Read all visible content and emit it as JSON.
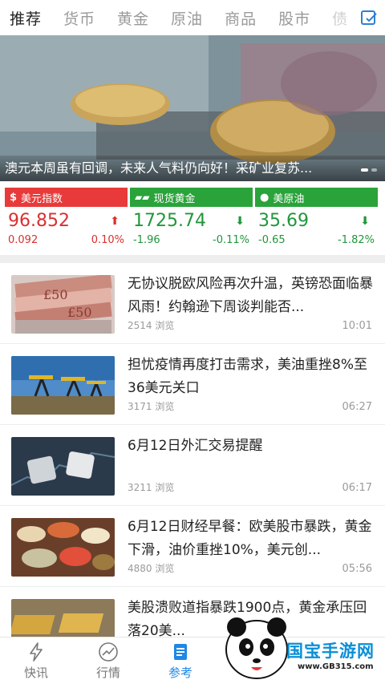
{
  "tabs": [
    "推荐",
    "货币",
    "黄金",
    "原油",
    "商品",
    "股市",
    "债"
  ],
  "banner": {
    "caption": "澳元本周虽有回调，未来人气料仍向好！采矿业复苏..."
  },
  "markets": [
    {
      "name": "美元指数",
      "price": "96.852",
      "change": "0.092",
      "percent": "0.10%",
      "trend": "up",
      "color": "#e83a3a"
    },
    {
      "name": "现货黄金",
      "price": "1725.74",
      "change": "-1.96",
      "percent": "-0.11%",
      "trend": "down",
      "color": "#2aa33a"
    },
    {
      "name": "美原油",
      "price": "35.69",
      "change": "-0.65",
      "percent": "-1.82%",
      "trend": "down",
      "color": "#2aa33a"
    }
  ],
  "news": [
    {
      "title": "无协议脱欧风险再次升温，英镑恐面临暴风雨！约翰逊下周谈判能否...",
      "views": "2514 浏览",
      "time": "10:01",
      "thumb": "banknotes"
    },
    {
      "title": "担忧疫情再度打击需求，美油重挫8%至36美元关口",
      "views": "3171 浏览",
      "time": "06:27",
      "thumb": "oil-pumps"
    },
    {
      "title": "6月12日外汇交易提醒",
      "views": "3211 浏览",
      "time": "06:17",
      "thumb": "buy-sell-dice"
    },
    {
      "title": "6月12日财经早餐：欧美股市暴跌，黄金下滑，油价重挫10%，美元创...",
      "views": "4880 浏览",
      "time": "05:56",
      "thumb": "food-table"
    },
    {
      "title": "美股溃败道指暴跌1900点，黄金承压回落20美...",
      "views": "",
      "time": "",
      "thumb": "gold-bars"
    }
  ],
  "bottom_nav": [
    {
      "label": "快讯",
      "icon": "lightning-icon"
    },
    {
      "label": "行情",
      "icon": "chart-circle-icon"
    },
    {
      "label": "参考",
      "icon": "document-icon"
    }
  ],
  "watermark": {
    "text": "国宝手游网",
    "url": "www.GB315.com"
  }
}
